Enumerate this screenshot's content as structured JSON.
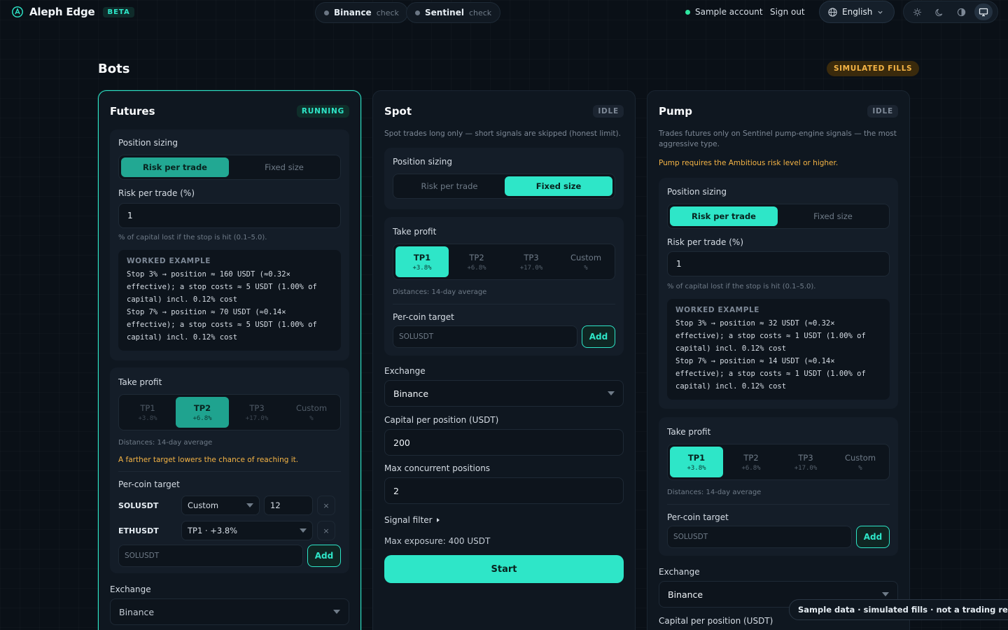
{
  "brand": {
    "name": "Aleph Edge",
    "badge": "BETA"
  },
  "status_pills": [
    {
      "name": "Binance",
      "sub": "check"
    },
    {
      "name": "Sentinel",
      "sub": "check"
    }
  ],
  "account": {
    "label": "Sample account",
    "signout": "Sign out"
  },
  "language": {
    "selected": "English"
  },
  "page": {
    "title": "Bots",
    "mode_badge": "SIMULATED FILLS"
  },
  "futures": {
    "title": "Futures",
    "status": "RUNNING",
    "sizing_label": "Position sizing",
    "sizing_options": [
      "Risk per trade",
      "Fixed size"
    ],
    "risk_label": "Risk per trade (%)",
    "risk_value": "1",
    "risk_hint": "% of capital lost if the stop is hit (0.1–5.0).",
    "worked_title": "WORKED EXAMPLE",
    "worked_lines": [
      "Stop 3% → position ≈ 160 USDT (≈0.32×\neffective); a stop costs ≈ 5 USDT (1.00% of\ncapital) incl. 0.12% cost",
      "Stop 7% → position ≈ 70 USDT (≈0.14×\neffective); a stop costs ≈ 5 USDT (1.00% of\ncapital) incl. 0.12% cost"
    ],
    "tp_label": "Take profit",
    "tp_options": [
      {
        "label": "TP1",
        "value": "+3.8%"
      },
      {
        "label": "TP2",
        "value": "+6.8%"
      },
      {
        "label": "TP3",
        "value": "+17.0%"
      },
      {
        "label": "Custom",
        "value": "%"
      }
    ],
    "tp_hint": "Distances: 14-day average",
    "tp_warning": "A farther target lowers the chance of reaching it.",
    "percoin_label": "Per-coin target",
    "coins": [
      {
        "symbol": "SOLUSDT",
        "target": "Custom",
        "value": "12",
        "remove": "×"
      },
      {
        "symbol": "ETHUSDT",
        "target": "TP1 · +3.8%",
        "remove": "×"
      }
    ],
    "add_placeholder": "SOLUSDT",
    "add_label": "Add",
    "exchange_label": "Exchange",
    "exchange_value": "Binance"
  },
  "spot": {
    "title": "Spot",
    "status": "IDLE",
    "description": "Spot trades long only — short signals are skipped (honest limit).",
    "sizing_label": "Position sizing",
    "sizing_options": [
      "Risk per trade",
      "Fixed size"
    ],
    "tp_label": "Take profit",
    "tp_options": [
      {
        "label": "TP1",
        "value": "+3.8%"
      },
      {
        "label": "TP2",
        "value": "+6.8%"
      },
      {
        "label": "TP3",
        "value": "+17.0%"
      },
      {
        "label": "Custom",
        "value": "%"
      }
    ],
    "tp_hint": "Distances: 14-day average",
    "percoin_label": "Per-coin target",
    "add_placeholder": "SOLUSDT",
    "add_label": "Add",
    "exchange_label": "Exchange",
    "exchange_value": "Binance",
    "capital_label": "Capital per position (USDT)",
    "capital_value": "200",
    "maxpos_label": "Max concurrent positions",
    "maxpos_value": "2",
    "signal_label": "Signal filter",
    "exposure": "Max exposure: 400 USDT",
    "start_label": "Start"
  },
  "pump": {
    "title": "Pump",
    "status": "IDLE",
    "description": "Trades futures only on Sentinel pump-engine signals — the most aggressive type.",
    "warning": "Pump requires the Ambitious risk level or higher.",
    "sizing_label": "Position sizing",
    "sizing_options": [
      "Risk per trade",
      "Fixed size"
    ],
    "risk_label": "Risk per trade (%)",
    "risk_value": "1",
    "risk_hint": "% of capital lost if the stop is hit (0.1–5.0).",
    "worked_title": "WORKED EXAMPLE",
    "worked_lines": [
      "Stop 3% → position ≈ 32 USDT (≈0.32×\neffective); a stop costs ≈ 1 USDT (1.00% of\ncapital) incl. 0.12% cost",
      "Stop 7% → position ≈ 14 USDT (≈0.14×\neffective); a stop costs ≈ 1 USDT (1.00% of\ncapital) incl. 0.12% cost"
    ],
    "tp_label": "Take profit",
    "tp_options": [
      {
        "label": "TP1",
        "value": "+3.8%"
      },
      {
        "label": "TP2",
        "value": "+6.8%"
      },
      {
        "label": "TP3",
        "value": "+17.0%"
      },
      {
        "label": "Custom",
        "value": "%"
      }
    ],
    "tp_hint": "Distances: 14-day average",
    "percoin_label": "Per-coin target",
    "add_placeholder": "SOLUSDT",
    "add_label": "Add",
    "exchange_label": "Exchange",
    "exchange_value": "Binance",
    "capital_label": "Capital per position (USDT)"
  },
  "toast": "Sample data · simulated fills · not a trading record",
  "colors": {
    "accent": "#2ee6c8",
    "warning": "#f5b445",
    "background": "#0a1017",
    "card": "#0f1720"
  },
  "icons": [
    "logo-icon",
    "globe-icon",
    "chevron-down-icon",
    "sun-icon",
    "moon-icon",
    "contrast-icon",
    "monitor-icon",
    "caret-down-icon",
    "close-icon"
  ]
}
